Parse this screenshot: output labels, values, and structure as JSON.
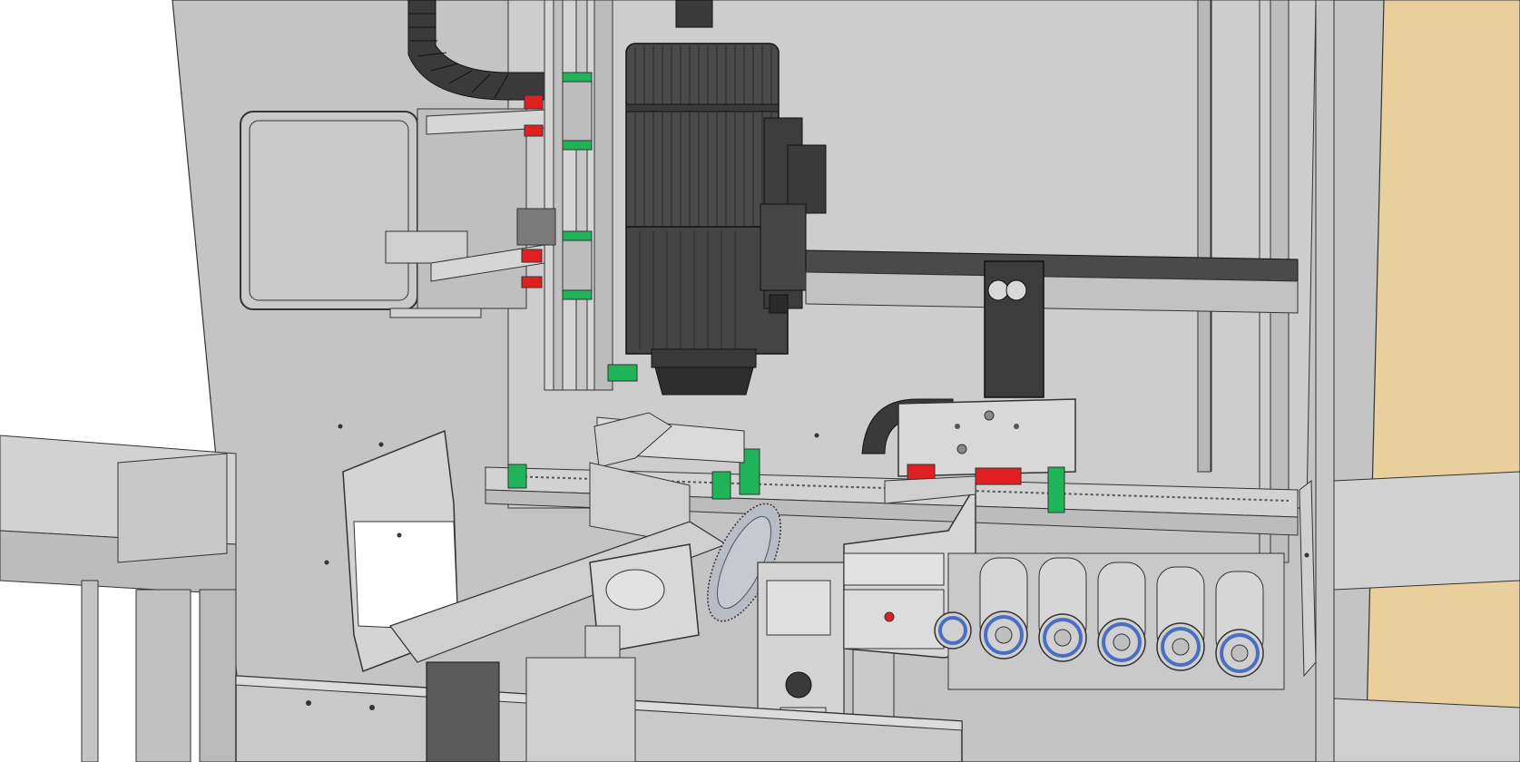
{
  "scene": {
    "subject": "cad-machine-assembly",
    "colors": {
      "background": "#ffffff",
      "frame": "#c4c4c4",
      "frame_light": "#d6d6d6",
      "frame_dark": "#a8a8a8",
      "outline": "#333333",
      "spindle": "#4a4a4a",
      "spindle_dark": "#2e2e2e",
      "rail_block_green": "#1fb35a",
      "rail_block_red": "#e02020",
      "bearing_blue": "#4a6fc0",
      "wood_panel": "#e8cf9c",
      "saw_blade": "#b8bcc4"
    },
    "parts": [
      "frame-panel-left",
      "spindle-motor",
      "z-axis-linear-rail",
      "x-axis-linear-rail",
      "electrical-box",
      "cable-chain",
      "carriage-plate",
      "saw-blade",
      "roller-conveyor",
      "guard-plate",
      "wood-panel-right"
    ]
  }
}
